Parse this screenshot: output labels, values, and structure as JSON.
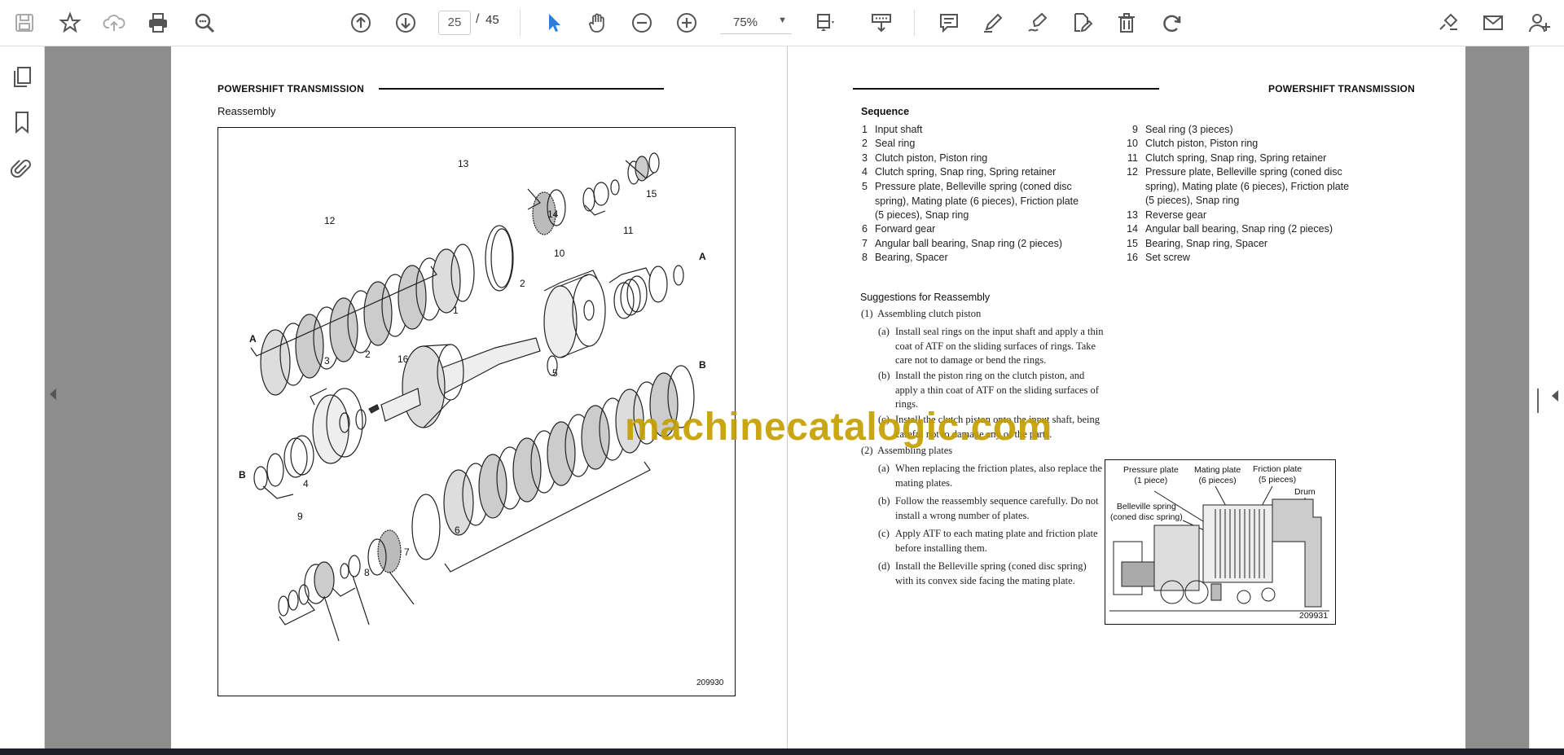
{
  "toolbar": {
    "page_current": "25",
    "page_separator": "/",
    "page_total": "45",
    "zoom": "75%"
  },
  "left_page": {
    "header": "POWERSHIFT TRANSMISSION",
    "title": "Reassembly",
    "figure_number": "209930",
    "part_labels": [
      "1",
      "2",
      "2",
      "3",
      "4",
      "5",
      "6",
      "7",
      "8",
      "9",
      "10",
      "11",
      "12",
      "13",
      "14",
      "15",
      "16",
      "A",
      "A",
      "B",
      "B"
    ]
  },
  "right_page": {
    "header": "POWERSHIFT TRANSMISSION",
    "sequence_title": "Sequence",
    "sequence_left": [
      {
        "n": "1",
        "t": "Input shaft"
      },
      {
        "n": "2",
        "t": "Seal ring"
      },
      {
        "n": "3",
        "t": "Clutch piston, Piston ring"
      },
      {
        "n": "4",
        "t": "Clutch spring, Snap ring, Spring retainer"
      },
      {
        "n": "5",
        "t": "Pressure plate, Belleville spring (coned disc\nspring), Mating plate (6 pieces), Friction plate\n(5 pieces), Snap ring"
      },
      {
        "n": "6",
        "t": "Forward gear"
      },
      {
        "n": "7",
        "t": "Angular ball bearing, Snap ring (2 pieces)"
      },
      {
        "n": "8",
        "t": "Bearing, Spacer"
      }
    ],
    "sequence_right": [
      {
        "n": "9",
        "t": "Seal ring (3 pieces)"
      },
      {
        "n": "10",
        "t": "Clutch piston, Piston ring"
      },
      {
        "n": "11",
        "t": "Clutch spring, Snap ring, Spring retainer"
      },
      {
        "n": "12",
        "t": "Pressure plate, Belleville spring (coned disc\nspring), Mating plate (6 pieces), Friction plate\n(5 pieces), Snap ring"
      },
      {
        "n": "13",
        "t": "Reverse gear"
      },
      {
        "n": "14",
        "t": "Angular ball bearing, Snap ring (2 pieces)"
      },
      {
        "n": "15",
        "t": "Bearing, Snap ring, Spacer"
      },
      {
        "n": "16",
        "t": "Set screw"
      }
    ],
    "suggestions_title": "Suggestions for Reassembly",
    "step1": "(1)  Assembling clutch piston",
    "step1a_label": "(a)",
    "step1a": "Install seal rings on the input shaft and apply a thin\ncoat of ATF on the sliding surfaces of rings.  Take\ncare not to damage or bend the rings.",
    "step1b_label": "(b)",
    "step1b": "Install the piston ring on the clutch piston, and\napply a thin coat of ATF on the sliding surfaces of\nrings.",
    "step1c_label": "(c)",
    "step1c": "Install the clutch piston onto the input shaft, being\ncareful not to damage any of the parts.",
    "step2": "(2)  Assembling plates",
    "step2a_label": "(a)",
    "step2a": "When replacing the friction plates, also replace the\nmating plates.",
    "step2b_label": "(b)",
    "step2b": "Follow the reassembly sequence carefully.  Do not\ninstall a wrong number of plates.",
    "step2c_label": "(c)",
    "step2c": "Apply ATF to each mating plate and friction plate\nbefore installing them.",
    "step2d_label": "(d)",
    "step2d": "Install the Belleville spring (coned disc spring)\nwith its convex side facing the mating plate.",
    "diagram": {
      "pressure_plate": "Pressure plate\n(1 piece)",
      "mating_plate": "Mating plate\n(6 pieces)",
      "friction_plate": "Friction plate\n(5 pieces)",
      "drum": "Drum",
      "belleville": "Belleville spring\n(coned disc spring)",
      "figure_number": "209931"
    }
  },
  "watermark": "machinecatalogic.com"
}
